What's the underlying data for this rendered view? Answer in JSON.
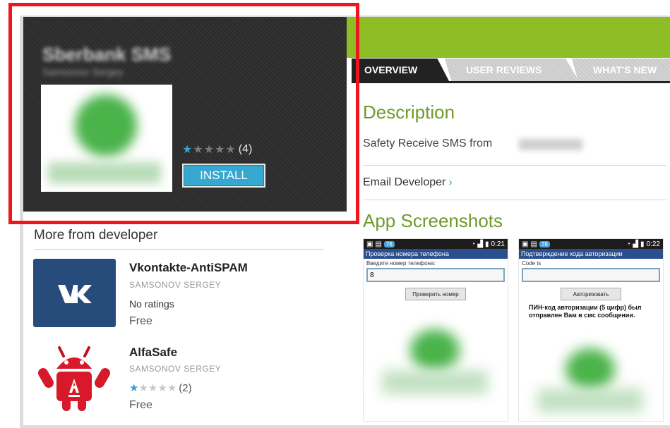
{
  "hero": {
    "app_title": "Sberbank SMS",
    "developer": "Samsonov Sergey",
    "rating_count": "(4)",
    "rating_stars": 1,
    "install_label": "INSTALL"
  },
  "more_from_developer": {
    "title": "More from developer",
    "items": [
      {
        "name": "Vkontakte-AntiSPAM",
        "developer": "SAMSONOV SERGEY",
        "rating_text": "No ratings",
        "price": "Free",
        "icon": "vk-logo-icon"
      },
      {
        "name": "AlfaSafe",
        "developer": "SAMSONOV SERGEY",
        "rating_count": "(2)",
        "rating_stars": 1,
        "price": "Free",
        "icon": "android-robot-icon"
      }
    ]
  },
  "tabs": [
    {
      "label": "OVERVIEW",
      "active": true
    },
    {
      "label": "USER REVIEWS",
      "active": false
    },
    {
      "label": "WHAT'S NEW",
      "active": false
    }
  ],
  "description": {
    "title": "Description",
    "text": "Safety Receive SMS from",
    "email_developer": "Email Developer",
    "email_chevron": "›"
  },
  "screenshots": {
    "title": "App Screenshots",
    "phone1": {
      "time": "0:21",
      "tag": "76",
      "header": "Проверка номера телефона",
      "label": "Введите номер телефона:",
      "input_value": "8",
      "button": "Проверить номер"
    },
    "phone2": {
      "time": "0:22",
      "tag": "76",
      "header": "Подтверждение кода авторизации",
      "label": "Code is",
      "input_value": "",
      "button": "Авторизовать",
      "note": "ПИН-код авторизации (5 цифр) был отправлен Вам в смс сообщении."
    }
  },
  "colors": {
    "accent_green": "#8dbe25",
    "title_green": "#6f9a2b",
    "install_blue": "#36a7cf",
    "highlight_red": "#f0151d"
  }
}
